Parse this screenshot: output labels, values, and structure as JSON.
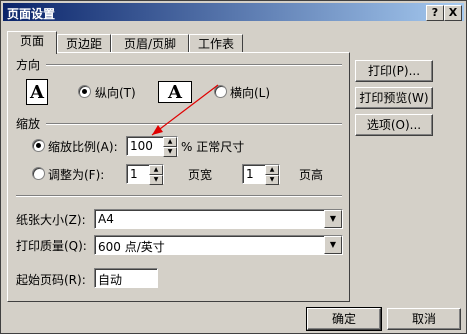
{
  "window": {
    "title": "页面设置",
    "help_button": "?",
    "close_button": "X"
  },
  "tabs": [
    {
      "label": "页面",
      "active": true
    },
    {
      "label": "页边距",
      "active": false
    },
    {
      "label": "页眉/页脚",
      "active": false
    },
    {
      "label": "工作表",
      "active": false
    }
  ],
  "orientation": {
    "section_label": "方向",
    "portrait_icon_glyph": "A",
    "landscape_icon_glyph": "A",
    "portrait_label": "纵向(T)",
    "landscape_label": "横向(L)",
    "selected": "portrait"
  },
  "scaling": {
    "section_label": "缩放",
    "adjust_to_label": "缩放比例(A):",
    "adjust_to_value": "100",
    "adjust_to_suffix": "% 正常尺寸",
    "fit_to_label": "调整为(F):",
    "fit_pages_wide_value": "1",
    "fit_pages_wide_label": "页宽",
    "fit_pages_tall_value": "1",
    "fit_pages_tall_label": "页高",
    "selected": "adjust"
  },
  "paper_size": {
    "label": "纸张大小(Z):",
    "value": "A4"
  },
  "print_quality": {
    "label": "打印质量(Q):",
    "value": "600 点/英寸"
  },
  "first_page_number": {
    "label": "起始页码(R):",
    "value": "自动"
  },
  "side_buttons": {
    "print": "打印(P)...",
    "print_preview": "打印预览(W)",
    "options": "选项(O)..."
  },
  "footer_buttons": {
    "ok": "确定",
    "cancel": "取消"
  },
  "colors": {
    "dialog_bg": "#d4d0c8",
    "title_start": "#0a246a",
    "title_end": "#a6caf0",
    "annotation_arrow": "#e00000"
  }
}
